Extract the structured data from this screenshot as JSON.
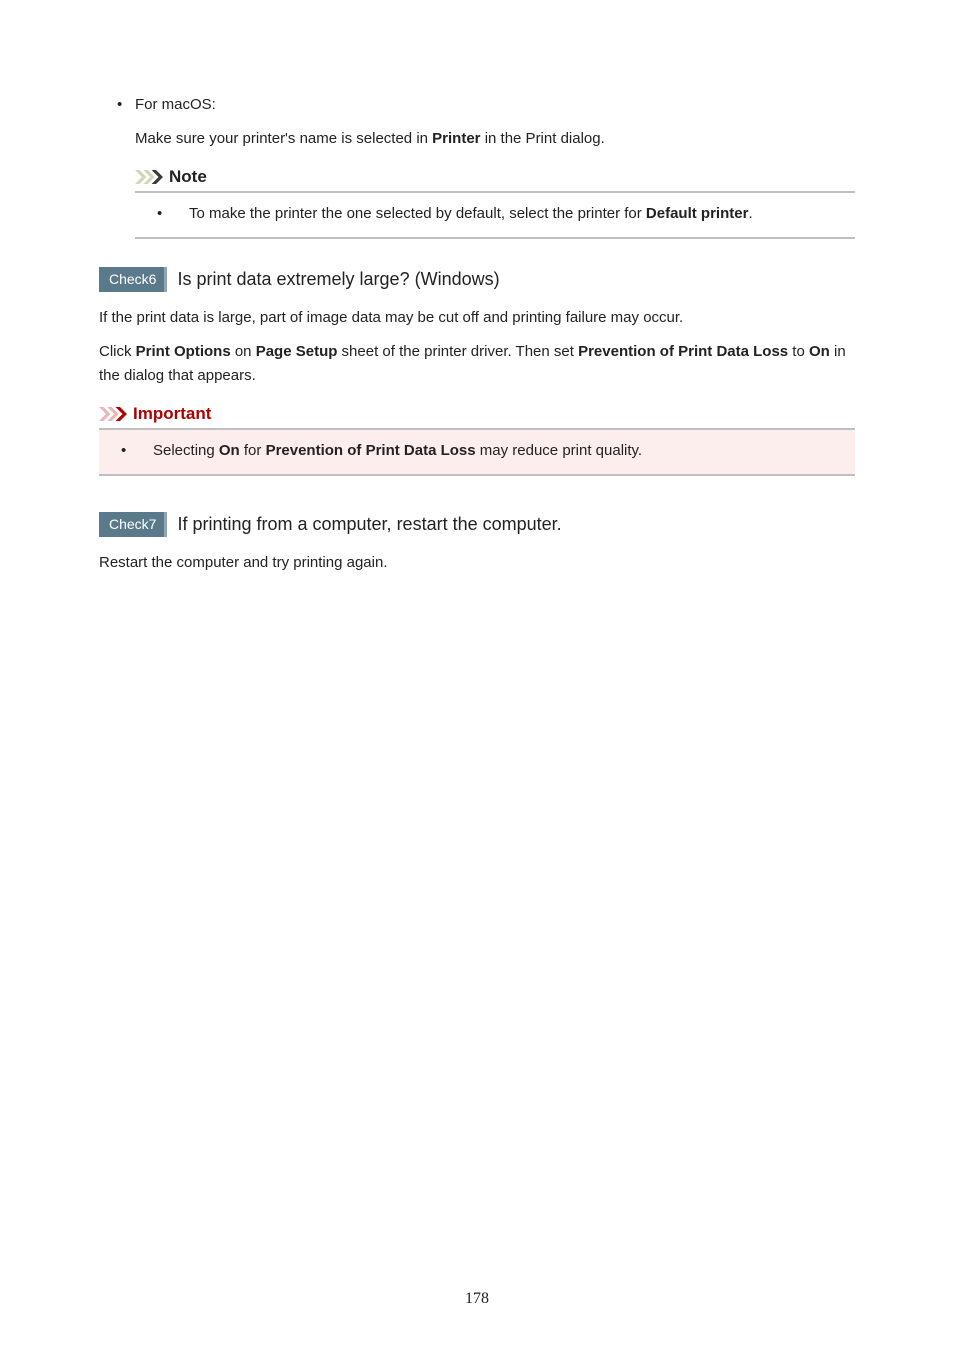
{
  "list": {
    "macos_header": "For macOS:",
    "macos_line_pre": "Make sure your printer's name is selected in ",
    "macos_line_bold": "Printer",
    "macos_line_post": " in the Print dialog."
  },
  "note": {
    "title": "Note",
    "bullet_pre": "To make the printer the one selected by default, select the printer for ",
    "bullet_bold": "Default printer",
    "bullet_post": "."
  },
  "check6": {
    "badge": "Check6",
    "question": "Is print data extremely large? (Windows)",
    "para1": "If the print data is large, part of image data may be cut off and printing failure may occur.",
    "para2_1": "Click ",
    "para2_b1": "Print Options",
    "para2_2": " on ",
    "para2_b2": "Page Setup",
    "para2_3": " sheet of the printer driver. Then set ",
    "para2_b3": "Prevention of Print Data Loss",
    "para2_4": " to ",
    "para2_b4": "On",
    "para2_5": " in the dialog that appears."
  },
  "important": {
    "title": "Important",
    "bullet_1": "Selecting ",
    "bullet_b1": "On",
    "bullet_2": " for ",
    "bullet_b2": "Prevention of Print Data Loss",
    "bullet_3": " may reduce print quality."
  },
  "check7": {
    "badge": "Check7",
    "question": "If printing from a computer, restart the computer.",
    "para": "Restart the computer and try printing again."
  },
  "page_number": "178"
}
